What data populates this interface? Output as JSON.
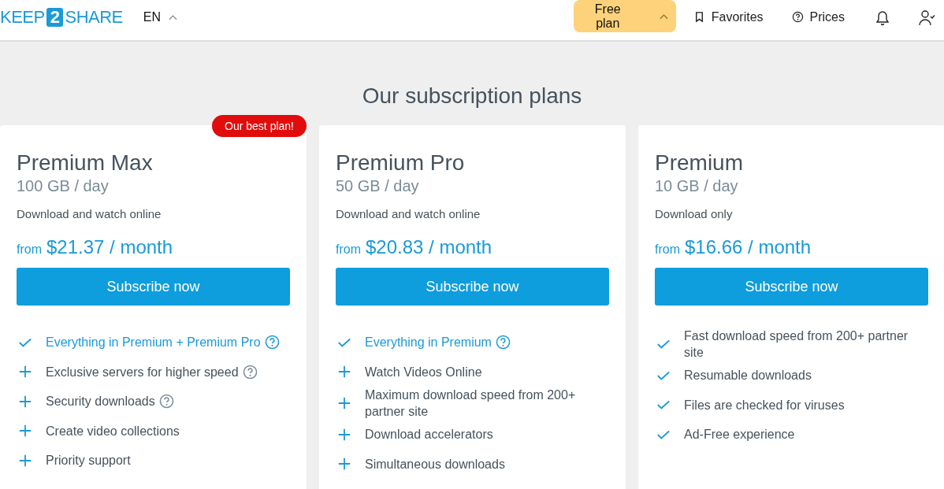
{
  "header": {
    "logo": {
      "left": "KEEP",
      "mark": "2",
      "right": "SHARE"
    },
    "language": "EN",
    "plan_button": "Free plan",
    "nav": [
      {
        "label": "Favorites",
        "kind": "bookmark"
      },
      {
        "label": "Prices",
        "kind": "help"
      }
    ]
  },
  "title": "Our subscription plans",
  "plans": [
    {
      "name": "Premium Max",
      "quota": "100 GB / day",
      "description": "Download and watch online",
      "price_prefix": "from",
      "price": "$21.37 / month",
      "button": "Subscribe now",
      "badge": "Our best plan!",
      "features": [
        {
          "text": "Everything in Premium + Premium Pro",
          "kind": "check",
          "highlight": true,
          "help": true
        },
        {
          "text": "Exclusive servers for higher speed",
          "kind": "plus",
          "highlight": false,
          "help": true
        },
        {
          "text": "Security downloads",
          "kind": "plus",
          "highlight": false,
          "help": true
        },
        {
          "text": "Create video collections",
          "kind": "plus",
          "highlight": false,
          "help": false
        },
        {
          "text": "Priority support",
          "kind": "plus",
          "highlight": false,
          "help": false
        }
      ]
    },
    {
      "name": "Premium Pro",
      "quota": "50 GB / day",
      "description": "Download and watch online",
      "price_prefix": "from",
      "price": "$20.83 / month",
      "button": "Subscribe now",
      "features": [
        {
          "text": "Everything in Premium",
          "kind": "check",
          "highlight": true,
          "help": true
        },
        {
          "text": "Watch Videos Online",
          "kind": "plus",
          "highlight": false,
          "help": false
        },
        {
          "text": "Maximum download speed from 200+ partner site",
          "kind": "plus",
          "highlight": false,
          "help": false
        },
        {
          "text": "Download accelerators",
          "kind": "plus",
          "highlight": false,
          "help": false
        },
        {
          "text": "Simultaneous downloads",
          "kind": "plus",
          "highlight": false,
          "help": false
        }
      ]
    },
    {
      "name": "Premium",
      "quota": "10 GB / day",
      "description": "Download only",
      "price_prefix": "from",
      "price": "$16.66 / month",
      "button": "Subscribe now",
      "features": [
        {
          "text": "Fast download speed from 200+ partner site",
          "kind": "check",
          "highlight": false,
          "help": false
        },
        {
          "text": "Resumable downloads",
          "kind": "check",
          "highlight": false,
          "help": false
        },
        {
          "text": "Files are checked for viruses",
          "kind": "check",
          "highlight": false,
          "help": false
        },
        {
          "text": "Ad-Free experience",
          "kind": "check",
          "highlight": false,
          "help": false
        }
      ]
    }
  ]
}
